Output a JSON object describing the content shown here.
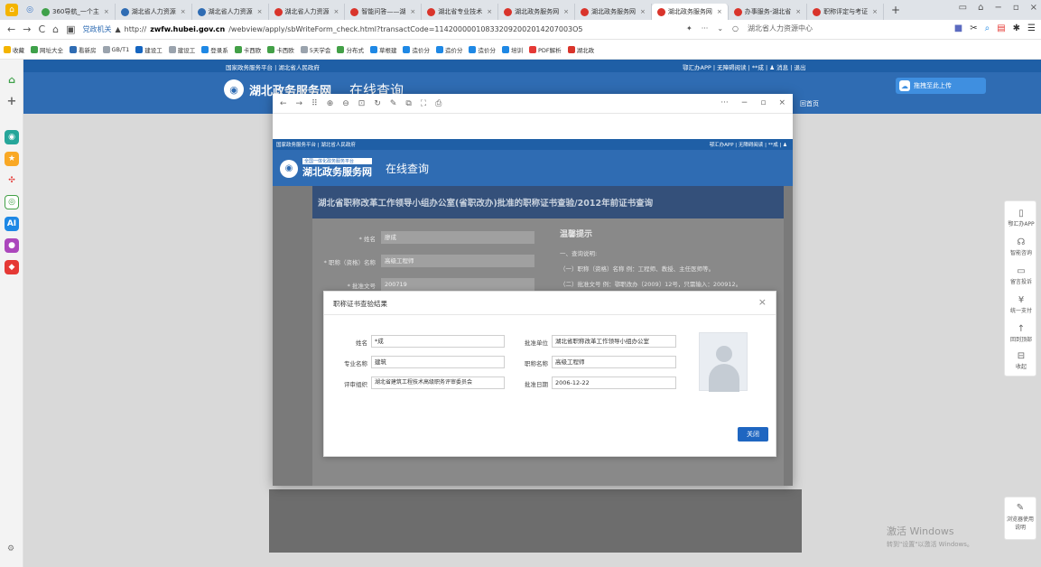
{
  "browser": {
    "tabs": [
      {
        "label": "360导航_一个主",
        "color": "#3fa14a",
        "active": false
      },
      {
        "label": "湖北省人力资源",
        "color": "#2f6cb3",
        "active": false
      },
      {
        "label": "湖北省人力资源",
        "color": "#2f6cb3",
        "active": false
      },
      {
        "label": "湖北省人力资源",
        "color": "#d9342b",
        "active": false
      },
      {
        "label": "智能问答——湖",
        "color": "#d9342b",
        "active": false
      },
      {
        "label": "湖北省专业技术",
        "color": "#d9342b",
        "active": false
      },
      {
        "label": "湖北政务服务网",
        "color": "#d9342b",
        "active": false
      },
      {
        "label": "湖北政务服务网",
        "color": "#d9342b",
        "active": false
      },
      {
        "label": "湖北政务服务网",
        "color": "#d9342b",
        "active": true
      },
      {
        "label": "办事服务-湖北省",
        "color": "#d9342b",
        "active": false
      },
      {
        "label": "职称评定与考证",
        "color": "#d9342b",
        "active": false
      }
    ],
    "url_prefix": "http://",
    "url_host": "zwfw.hubei.gov.cn",
    "url_path": "/webview/apply/sbWriteForm_check.html?transactCode=114200000108332092002014207003O5",
    "address_badge": "党政机关",
    "search_placeholder": "湖北省人力资源中心",
    "bookmarks": [
      "收藏",
      "网址大全",
      "看新房",
      "GB/T1",
      "建设工",
      "建设工",
      "登录系",
      "卡西欧",
      "卡西欧",
      "5天学会",
      "分布式",
      "草根建",
      "造价分",
      "造价分",
      "造价分",
      "培训",
      "PDF解析",
      "湖北政"
    ]
  },
  "page": {
    "top_left": "国家政务服务平台 | 湖北省人民政府",
    "top_right": "鄂汇办APP | 无障碍阅读 | **成 | ♟ 消息 | 退出",
    "upload_label": "拖拽至此上传",
    "logo_sub": "全国一体化政务服务平台",
    "logo_title": "湖北政务服务网",
    "online_query": "在线查询",
    "back_home": "回首页"
  },
  "popup": {
    "top_left": "国家政务服务平台 | 湖北省人民政府",
    "top_right": "鄂汇办APP | 无障碍阅读 | **成 | ♟",
    "logo_sub": "全国一体化政务服务平台",
    "logo_title": "湖北政务服务网",
    "online_query": "在线查询",
    "page_title": "湖北省职称改革工作领导小组办公室(省职改办)批准的职称证书查验/2012年前证书查询",
    "form": {
      "name_label": "* 姓名",
      "name_value": "廖成",
      "title_label": "* 职称（资格）名称",
      "title_value": "高级工程师",
      "doc_label": "* 批准文号",
      "doc_value": "200719"
    },
    "tips": {
      "heading": "温馨提示",
      "line1": "一、查询说明:",
      "line2": "（一）职称（资格）名称 例：工程师、教授、主任医师等。",
      "line3": "（二）批准文号 例：鄂职改办〔2009〕12号，只需输入：200912。"
    }
  },
  "modal": {
    "title": "职称证书查验结果",
    "fields": {
      "name_label": "姓名",
      "name_value": "*成",
      "unit_label": "批准单位",
      "unit_value": "湖北省职称改革工作领导小组办公室",
      "major_label": "专业名称",
      "major_value": "建筑",
      "title_label": "职称名称",
      "title_value": "高级工程师",
      "org_label": "评审组织",
      "org_value": "湖北省建筑工程技术高级职务评审委员会",
      "date_label": "批准日期",
      "date_value": "2006-12-22"
    },
    "close_button": "关闭"
  },
  "right_sidebar": {
    "items": [
      "鄂汇办APP",
      "智能咨询",
      "留言投诉",
      "统一支付",
      "回到顶部",
      "收起"
    ],
    "browser_help": "浏览器使用说明"
  },
  "watermark": {
    "line1": "激活 Windows",
    "line2": "转到\"设置\"以激活 Windows。"
  },
  "colors": {
    "brand_blue": "#2f6cb3",
    "top_strip": "#1f5fa6",
    "primary_button": "#1f66c1"
  }
}
